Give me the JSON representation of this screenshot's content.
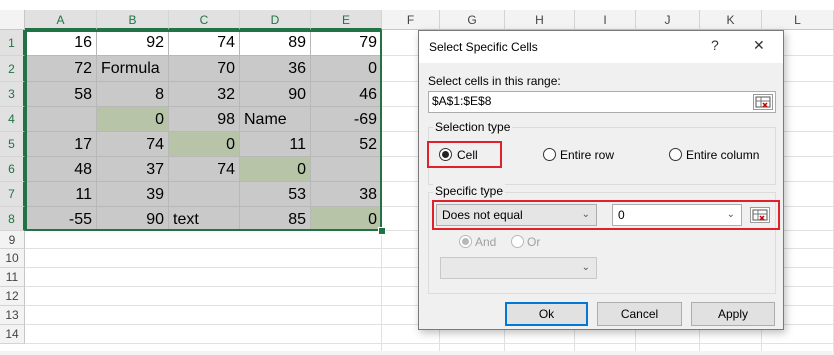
{
  "sheet": {
    "columns": [
      "A",
      "B",
      "C",
      "D",
      "E",
      "F",
      "G",
      "H",
      "I",
      "J",
      "K",
      "L"
    ],
    "rows": [
      "1",
      "2",
      "3",
      "4",
      "5",
      "6",
      "7",
      "8",
      "9",
      "10",
      "11",
      "12",
      "13",
      "14"
    ],
    "cells": [
      [
        "16",
        "92",
        "74",
        "89",
        "79"
      ],
      [
        "72",
        "Formula",
        "70",
        "36",
        "0"
      ],
      [
        "58",
        "8",
        "32",
        "90",
        "46"
      ],
      [
        "",
        "0",
        "98",
        "Name",
        "-69"
      ],
      [
        "17",
        "74",
        "0",
        "11",
        "52"
      ],
      [
        "48",
        "37",
        "74",
        "0",
        ""
      ],
      [
        "11",
        "39",
        "",
        "53",
        "38"
      ],
      [
        "-55",
        "90",
        "text",
        "85",
        "0"
      ]
    ]
  },
  "dialog": {
    "title": "Select Specific Cells",
    "help": "?",
    "close": "✕",
    "range_label": "Select cells in this range:",
    "range_value": "$A$1:$E$8",
    "selection_type": {
      "legend": "Selection type",
      "options": [
        "Cell",
        "Entire row",
        "Entire column"
      ],
      "selected": "Cell"
    },
    "specific_type": {
      "legend": "Specific type",
      "condition": "Does not equal",
      "value": "0",
      "and_label": "And",
      "or_label": "Or"
    },
    "buttons": {
      "ok": "Ok",
      "cancel": "Cancel",
      "apply": "Apply"
    }
  },
  "colors": {
    "selection": "#217346",
    "highlight": "#e0202a",
    "selected_cell": "#b7c4a8",
    "range_fill": "#c9c9c9"
  }
}
